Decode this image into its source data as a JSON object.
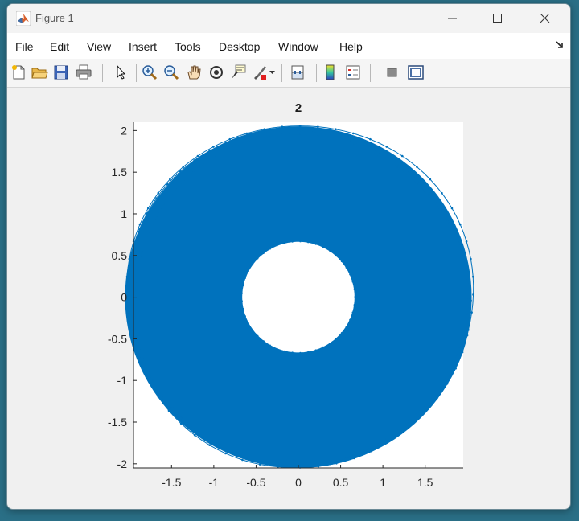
{
  "window": {
    "title": "Figure 1"
  },
  "menu": {
    "items": [
      "File",
      "Edit",
      "View",
      "Insert",
      "Tools",
      "Desktop",
      "Window",
      "Help"
    ]
  },
  "toolbar": {
    "buttons": [
      {
        "name": "new-figure-icon"
      },
      {
        "name": "open-file-icon"
      },
      {
        "name": "save-icon"
      },
      {
        "name": "print-icon"
      },
      {
        "name": "select-arrow-icon"
      },
      {
        "name": "zoom-in-icon"
      },
      {
        "name": "zoom-out-icon"
      },
      {
        "name": "pan-hand-icon"
      },
      {
        "name": "rotate-3d-icon"
      },
      {
        "name": "data-cursor-icon"
      },
      {
        "name": "brush-icon"
      },
      {
        "name": "link-plot-icon"
      },
      {
        "name": "colorbar-icon"
      },
      {
        "name": "legend-icon"
      },
      {
        "name": "hide-plot-tools-icon"
      },
      {
        "name": "show-plot-tools-icon"
      }
    ]
  },
  "chart_data": {
    "type": "line",
    "title": "2",
    "xlabel": "",
    "ylabel": "",
    "xlim": [
      -1.95,
      1.95
    ],
    "ylim": [
      -2.05,
      2.1
    ],
    "xticks": [
      -1.5,
      -1,
      -0.5,
      0,
      0.5,
      1,
      1.5
    ],
    "xtick_labels": [
      "-1.5",
      "-1",
      "-0.5",
      "0",
      "0.5",
      "1",
      "1.5"
    ],
    "yticks": [
      -2,
      -1.5,
      -1,
      -0.5,
      0,
      0.5,
      1,
      1.5,
      2
    ],
    "ytick_labels": [
      "-2",
      "-1.5",
      "-1",
      "-0.5",
      "0",
      "0.5",
      "1",
      "1.5",
      "2"
    ],
    "grid": false,
    "series": [
      {
        "color": "#0072bd",
        "marker": "dot",
        "shape": "annulus",
        "center": [
          0,
          0
        ],
        "inner_radius": 0.67,
        "outer_radius": 2.05
      }
    ]
  }
}
